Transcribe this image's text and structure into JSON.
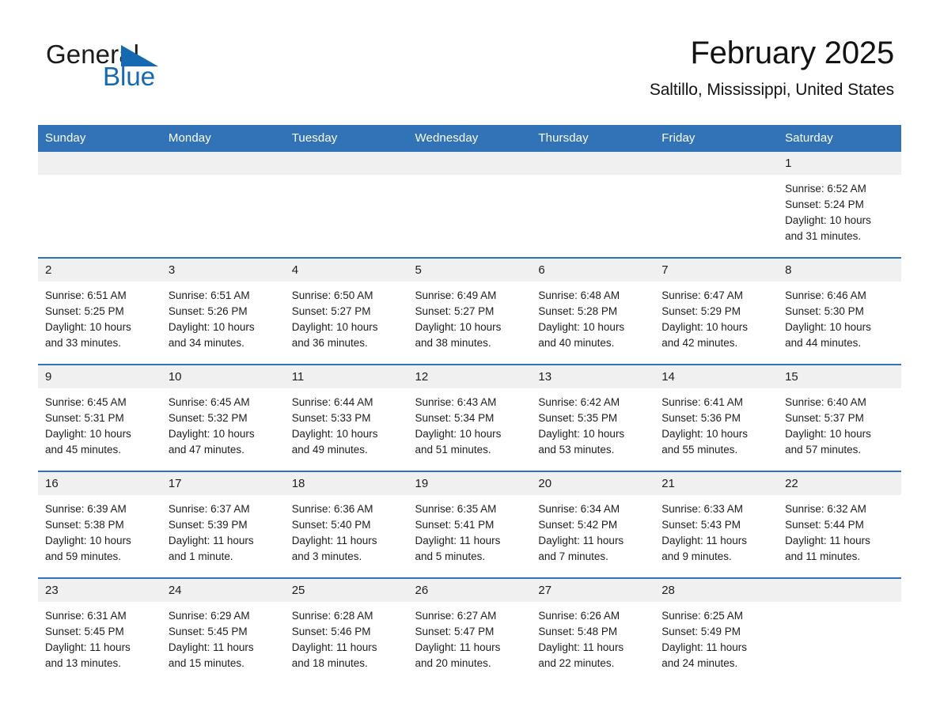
{
  "brand": {
    "name_part1": "General",
    "name_part2": "Blue",
    "accent_color": "#1469b0",
    "header_color": "#3173b6"
  },
  "header": {
    "title": "February 2025",
    "subtitle": "Saltillo, Mississippi, United States"
  },
  "calendar": {
    "weekday_headers": [
      "Sunday",
      "Monday",
      "Tuesday",
      "Wednesday",
      "Thursday",
      "Friday",
      "Saturday"
    ],
    "weeks": [
      [
        {
          "day": "",
          "lines": []
        },
        {
          "day": "",
          "lines": []
        },
        {
          "day": "",
          "lines": []
        },
        {
          "day": "",
          "lines": []
        },
        {
          "day": "",
          "lines": []
        },
        {
          "day": "",
          "lines": []
        },
        {
          "day": "1",
          "lines": [
            "Sunrise: 6:52 AM",
            "Sunset: 5:24 PM",
            "Daylight: 10 hours",
            "and 31 minutes."
          ]
        }
      ],
      [
        {
          "day": "2",
          "lines": [
            "Sunrise: 6:51 AM",
            "Sunset: 5:25 PM",
            "Daylight: 10 hours",
            "and 33 minutes."
          ]
        },
        {
          "day": "3",
          "lines": [
            "Sunrise: 6:51 AM",
            "Sunset: 5:26 PM",
            "Daylight: 10 hours",
            "and 34 minutes."
          ]
        },
        {
          "day": "4",
          "lines": [
            "Sunrise: 6:50 AM",
            "Sunset: 5:27 PM",
            "Daylight: 10 hours",
            "and 36 minutes."
          ]
        },
        {
          "day": "5",
          "lines": [
            "Sunrise: 6:49 AM",
            "Sunset: 5:27 PM",
            "Daylight: 10 hours",
            "and 38 minutes."
          ]
        },
        {
          "day": "6",
          "lines": [
            "Sunrise: 6:48 AM",
            "Sunset: 5:28 PM",
            "Daylight: 10 hours",
            "and 40 minutes."
          ]
        },
        {
          "day": "7",
          "lines": [
            "Sunrise: 6:47 AM",
            "Sunset: 5:29 PM",
            "Daylight: 10 hours",
            "and 42 minutes."
          ]
        },
        {
          "day": "8",
          "lines": [
            "Sunrise: 6:46 AM",
            "Sunset: 5:30 PM",
            "Daylight: 10 hours",
            "and 44 minutes."
          ]
        }
      ],
      [
        {
          "day": "9",
          "lines": [
            "Sunrise: 6:45 AM",
            "Sunset: 5:31 PM",
            "Daylight: 10 hours",
            "and 45 minutes."
          ]
        },
        {
          "day": "10",
          "lines": [
            "Sunrise: 6:45 AM",
            "Sunset: 5:32 PM",
            "Daylight: 10 hours",
            "and 47 minutes."
          ]
        },
        {
          "day": "11",
          "lines": [
            "Sunrise: 6:44 AM",
            "Sunset: 5:33 PM",
            "Daylight: 10 hours",
            "and 49 minutes."
          ]
        },
        {
          "day": "12",
          "lines": [
            "Sunrise: 6:43 AM",
            "Sunset: 5:34 PM",
            "Daylight: 10 hours",
            "and 51 minutes."
          ]
        },
        {
          "day": "13",
          "lines": [
            "Sunrise: 6:42 AM",
            "Sunset: 5:35 PM",
            "Daylight: 10 hours",
            "and 53 minutes."
          ]
        },
        {
          "day": "14",
          "lines": [
            "Sunrise: 6:41 AM",
            "Sunset: 5:36 PM",
            "Daylight: 10 hours",
            "and 55 minutes."
          ]
        },
        {
          "day": "15",
          "lines": [
            "Sunrise: 6:40 AM",
            "Sunset: 5:37 PM",
            "Daylight: 10 hours",
            "and 57 minutes."
          ]
        }
      ],
      [
        {
          "day": "16",
          "lines": [
            "Sunrise: 6:39 AM",
            "Sunset: 5:38 PM",
            "Daylight: 10 hours",
            "and 59 minutes."
          ]
        },
        {
          "day": "17",
          "lines": [
            "Sunrise: 6:37 AM",
            "Sunset: 5:39 PM",
            "Daylight: 11 hours",
            "and 1 minute."
          ]
        },
        {
          "day": "18",
          "lines": [
            "Sunrise: 6:36 AM",
            "Sunset: 5:40 PM",
            "Daylight: 11 hours",
            "and 3 minutes."
          ]
        },
        {
          "day": "19",
          "lines": [
            "Sunrise: 6:35 AM",
            "Sunset: 5:41 PM",
            "Daylight: 11 hours",
            "and 5 minutes."
          ]
        },
        {
          "day": "20",
          "lines": [
            "Sunrise: 6:34 AM",
            "Sunset: 5:42 PM",
            "Daylight: 11 hours",
            "and 7 minutes."
          ]
        },
        {
          "day": "21",
          "lines": [
            "Sunrise: 6:33 AM",
            "Sunset: 5:43 PM",
            "Daylight: 11 hours",
            "and 9 minutes."
          ]
        },
        {
          "day": "22",
          "lines": [
            "Sunrise: 6:32 AM",
            "Sunset: 5:44 PM",
            "Daylight: 11 hours",
            "and 11 minutes."
          ]
        }
      ],
      [
        {
          "day": "23",
          "lines": [
            "Sunrise: 6:31 AM",
            "Sunset: 5:45 PM",
            "Daylight: 11 hours",
            "and 13 minutes."
          ]
        },
        {
          "day": "24",
          "lines": [
            "Sunrise: 6:29 AM",
            "Sunset: 5:45 PM",
            "Daylight: 11 hours",
            "and 15 minutes."
          ]
        },
        {
          "day": "25",
          "lines": [
            "Sunrise: 6:28 AM",
            "Sunset: 5:46 PM",
            "Daylight: 11 hours",
            "and 18 minutes."
          ]
        },
        {
          "day": "26",
          "lines": [
            "Sunrise: 6:27 AM",
            "Sunset: 5:47 PM",
            "Daylight: 11 hours",
            "and 20 minutes."
          ]
        },
        {
          "day": "27",
          "lines": [
            "Sunrise: 6:26 AM",
            "Sunset: 5:48 PM",
            "Daylight: 11 hours",
            "and 22 minutes."
          ]
        },
        {
          "day": "28",
          "lines": [
            "Sunrise: 6:25 AM",
            "Sunset: 5:49 PM",
            "Daylight: 11 hours",
            "and 24 minutes."
          ]
        },
        {
          "day": "",
          "lines": []
        }
      ]
    ]
  }
}
